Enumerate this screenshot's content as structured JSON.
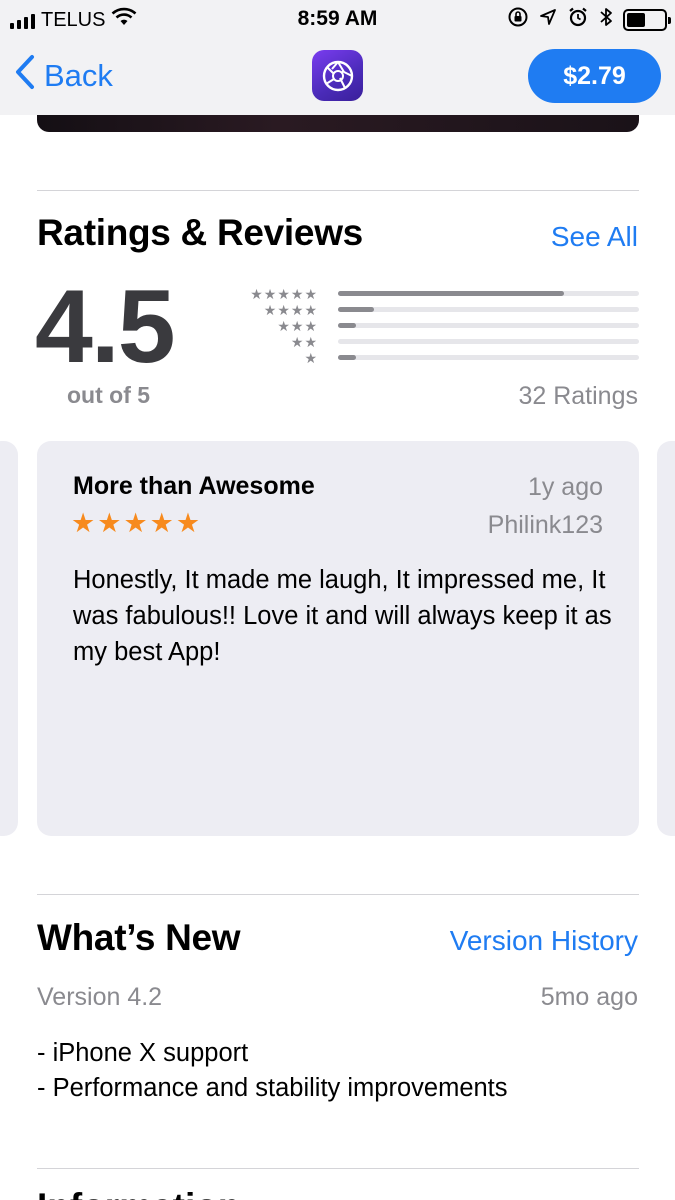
{
  "status_bar": {
    "carrier": "TELUS",
    "time": "8:59 AM",
    "icons": [
      "signal-icon",
      "wifi-icon",
      "rotation-lock-icon",
      "location-icon",
      "alarm-icon",
      "bluetooth-icon",
      "battery-icon"
    ]
  },
  "nav": {
    "back_label": "Back",
    "price_label": "$2.79",
    "app_icon": "camera-aperture-icon",
    "accent_color": "#1f7cf2"
  },
  "ratings": {
    "title": "Ratings & Reviews",
    "see_all": "See All",
    "average": "4.5",
    "out_of": "out of 5",
    "count_label": "32 Ratings",
    "distribution": [
      {
        "stars": 5,
        "fraction": 0.75
      },
      {
        "stars": 4,
        "fraction": 0.12
      },
      {
        "stars": 3,
        "fraction": 0.06
      },
      {
        "stars": 2,
        "fraction": 0.0
      },
      {
        "stars": 1,
        "fraction": 0.06
      }
    ]
  },
  "review": {
    "title": "More than Awesome",
    "date": "1y ago",
    "stars": 5,
    "author": "Philink123",
    "body": "Honestly, It made me laugh, It impressed me, It was fabulous!! Love it and will always keep it as my best App!",
    "star_color": "#f78a1d"
  },
  "whats_new": {
    "title": "What’s New",
    "link": "Version History",
    "version": "Version 4.2",
    "date": "5mo ago",
    "notes": [
      "- iPhone X support",
      "- Performance and stability improvements"
    ]
  },
  "information": {
    "title": "Information"
  }
}
